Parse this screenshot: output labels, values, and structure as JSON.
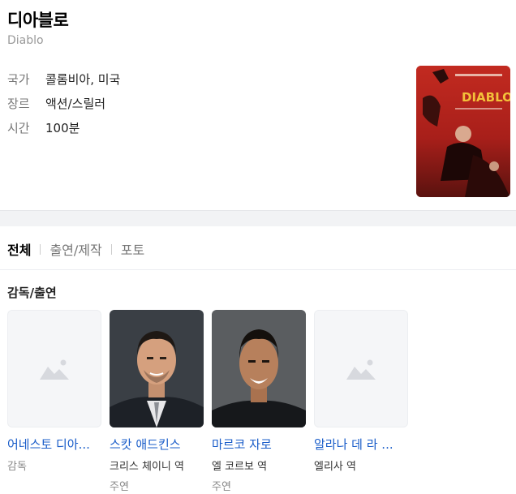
{
  "movie": {
    "title": "디아블로",
    "original_title": "Diablo",
    "poster_alt": "DIABLO poster"
  },
  "info": [
    {
      "key": "국가",
      "value": "콜롬비아, 미국"
    },
    {
      "key": "장르",
      "value": "액션/스릴러"
    },
    {
      "key": "시간",
      "value": "100분"
    }
  ],
  "tabs": [
    {
      "label": "전체",
      "active": true
    },
    {
      "label": "출연/제작",
      "active": false
    },
    {
      "label": "포토",
      "active": false
    }
  ],
  "section": {
    "title": "감독/출연"
  },
  "people": [
    {
      "name": "어네스토 디아...",
      "role": "감독",
      "role2": "",
      "has_photo": false
    },
    {
      "name": "스캇 애드킨스",
      "role": "크리스 체이니 역",
      "role2": "주연",
      "has_photo": true
    },
    {
      "name": "마르코 자로",
      "role": "엘 코르보 역",
      "role2": "주연",
      "has_photo": true
    },
    {
      "name": "알라나 데 라 ...",
      "role": "엘리사 역",
      "role2": "",
      "has_photo": false
    }
  ],
  "colors": {
    "link": "#1a5dc9",
    "poster_red": "#b0241d"
  }
}
